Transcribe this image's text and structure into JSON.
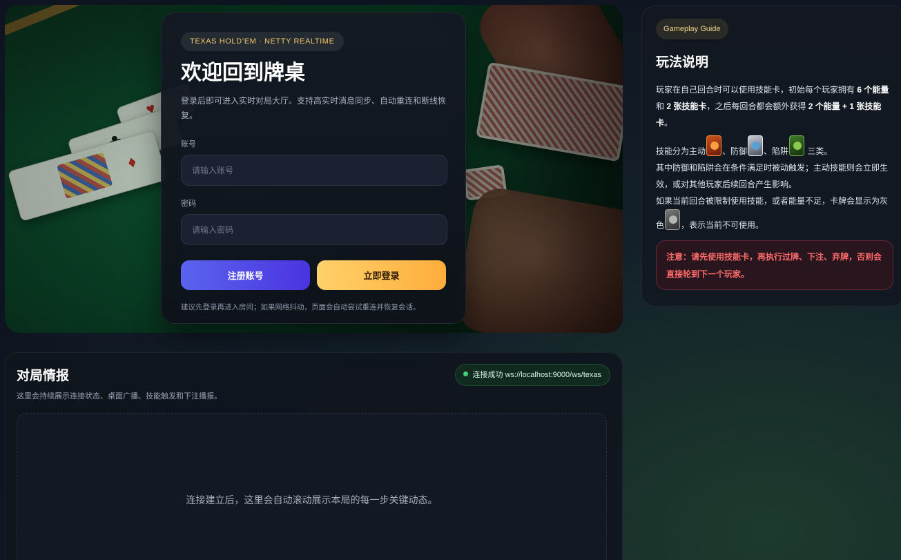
{
  "login": {
    "tag": "TEXAS HOLD’EM · NETTY REALTIME",
    "title": "欢迎回到牌桌",
    "description": "登录后即可进入实时对局大厅。支持高实时消息同步、自动重连和断线恢复。",
    "account_label": "账号",
    "account_placeholder": "请输入账号",
    "password_label": "密码",
    "password_placeholder": "请输入密码",
    "register_button": "注册账号",
    "login_button": "立即登录",
    "hint": "建议先登录再进入房间；如果网络抖动，页面会自动尝试重连并恢复会话。"
  },
  "guide": {
    "tag": "Gameplay Guide",
    "title": "玩法说明",
    "p1": {
      "t1": "玩家在自己回合时可以使用技能卡，初始每个玩家拥有 ",
      "b1": "6 个能量",
      "t2": " 和 ",
      "b2": "2 张技能卡",
      "t3": "，之后每回合都会额外获得 ",
      "b3": "2 个能量 + 1 张技能卡",
      "t4": "。"
    },
    "p2": {
      "t1": "技能分为主动",
      "t2": "、防御",
      "t3": "、陷阱",
      "t4": " 三类。"
    },
    "p3": "其中防御和陷阱会在条件满足时被动触发；主动技能则会立即生效，或对其他玩家后续回合产生影响。",
    "p4": {
      "t1": "如果当前回合被限制使用技能，或者能量不足，卡牌会显示为灰色",
      "t2": "，表示当前不可使用。"
    },
    "icons": [
      "skill-active-icon",
      "skill-defense-icon",
      "skill-trap-icon",
      "skill-gray-icon"
    ],
    "warning": "注意：请先使用技能卡，再执行过牌、下注、弃牌，否则会直接轮到下一个玩家。"
  },
  "feed": {
    "title": "对局情报",
    "subtitle": "这里会持续展示连接状态、桌面广播、技能触发和下注播报。",
    "status_text": "连接成功 ws://localhost:9000/ws/texas",
    "empty_text": "连接建立后，这里会自动滚动展示本局的每一步关键动态。"
  },
  "colors": {
    "accent_gold": "#ffbf4a",
    "accent_indigo": "#5b63ef",
    "success_green": "#41d27a",
    "warning_red": "#ff6b6b"
  }
}
